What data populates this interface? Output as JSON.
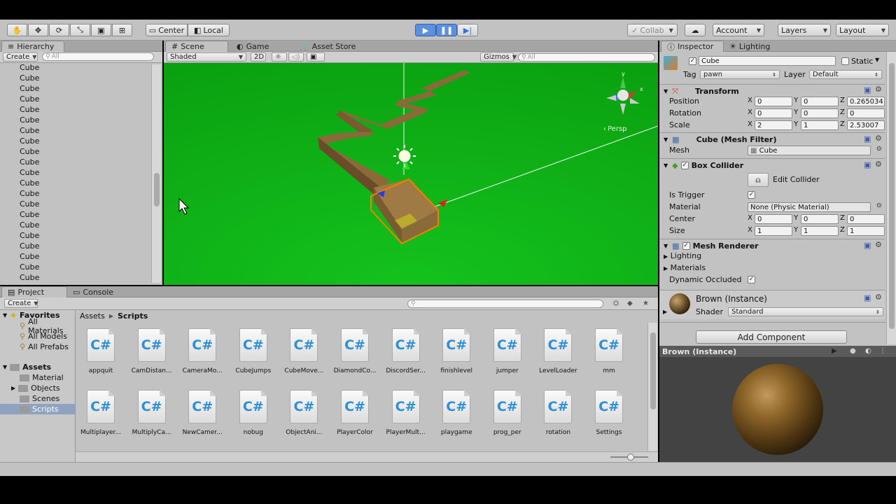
{
  "toolbar": {
    "center": "Center",
    "local": "Local",
    "collab": "Collab",
    "account": "Account",
    "layers": "Layers",
    "layout": "Layout"
  },
  "hierarchy": {
    "tab": "Hierarchy",
    "create": "Create",
    "search": "All",
    "items": [
      "Cube",
      "Cube",
      "Cube",
      "Cube",
      "Cube",
      "Cube",
      "Cube",
      "Cube",
      "Cube",
      "Cube",
      "Cube",
      "Cube",
      "Cube",
      "Cube",
      "Cube",
      "Cube",
      "Cube",
      "Cube",
      "Cube",
      "Cube",
      "Cube"
    ]
  },
  "scene": {
    "tab_scene": "Scene",
    "tab_game": "Game",
    "tab_store": "Asset Store",
    "shaded": "Shaded",
    "mode2d": "2D",
    "gizmos": "Gizmos",
    "search": "All",
    "persp": "Persp"
  },
  "project": {
    "tab_project": "Project",
    "tab_console": "Console",
    "create": "Create",
    "favorites": "Favorites",
    "fav_items": [
      "All Materials",
      "All Models",
      "All Prefabs"
    ],
    "assets": "Assets",
    "asset_folders": [
      "Material",
      "Objects",
      "Scenes",
      "Scripts"
    ],
    "breadcrumb_root": "Assets",
    "breadcrumb_current": "Scripts",
    "files": [
      "appquit",
      "CamDistan...",
      "CameraMo...",
      "CubeJumps",
      "CubeMove...",
      "DiamondCo...",
      "DiscordSer...",
      "finishlevel",
      "jumper",
      "LevelLoader",
      "mm",
      "Multiplayer...",
      "MultiplyCa...",
      "NewCamer...",
      "nobug",
      "ObjectAni...",
      "PlayerColor",
      "PlayerMult...",
      "playgame",
      "prog_per",
      "rotation",
      "Settings"
    ]
  },
  "inspector": {
    "tab_inspector": "Inspector",
    "tab_lighting": "Lighting",
    "object_name": "Cube",
    "static_label": "Static",
    "tag_label": "Tag",
    "tag_value": "pawn",
    "layer_label": "Layer",
    "layer_value": "Default",
    "transform": {
      "title": "Transform",
      "position": "Position",
      "rotation": "Rotation",
      "scale": "Scale",
      "x": "X",
      "y": "Y",
      "z": "Z",
      "pos": [
        "0",
        "0",
        "0.265034"
      ],
      "rot": [
        "0",
        "0",
        "0"
      ],
      "scl": [
        "2",
        "1",
        "2.53007"
      ]
    },
    "mesh_filter": {
      "title": "Cube (Mesh Filter)",
      "mesh_label": "Mesh",
      "mesh_value": "Cube"
    },
    "box_collider": {
      "title": "Box Collider",
      "edit": "Edit Collider",
      "is_trigger": "Is Trigger",
      "material": "Material",
      "material_value": "None (Physic Material)",
      "center": "Center",
      "size": "Size",
      "center_vals": [
        "0",
        "0",
        "0"
      ],
      "size_vals": [
        "1",
        "1",
        "1"
      ]
    },
    "mesh_renderer": {
      "title": "Mesh Renderer",
      "lighting": "Lighting",
      "materials": "Materials",
      "dynamic": "Dynamic Occluded"
    },
    "material": {
      "name": "Brown (Instance)",
      "shader_label": "Shader",
      "shader_value": "Standard"
    },
    "add_component": "Add Component",
    "preview_title": "Brown (Instance)"
  },
  "colors": {
    "ground": "#12b51a",
    "path": "#8b6a3a",
    "selection": "#ff7a00",
    "play": "#3a7ee8"
  }
}
